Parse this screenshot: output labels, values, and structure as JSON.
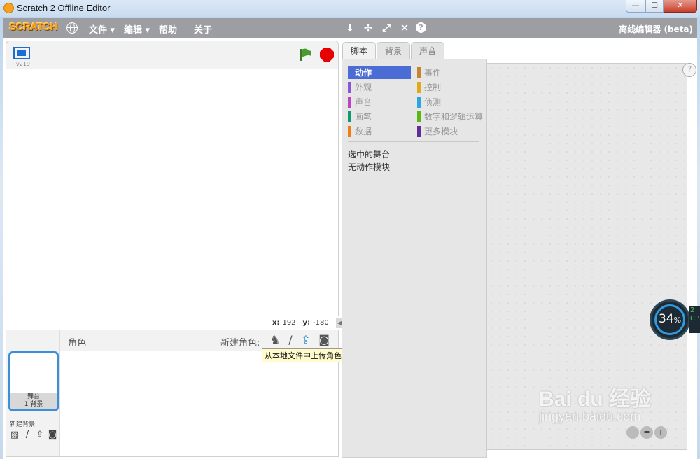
{
  "window": {
    "title": "Scratch 2 Offline Editor",
    "min": "—",
    "max": "☐",
    "close": "✕"
  },
  "menubar": {
    "logo": "SCRATCH",
    "file": "文件 ▾",
    "edit": "编辑 ▾",
    "help": "帮助",
    "about": "关于",
    "right_label": "离线编辑器 (beta)"
  },
  "stage": {
    "version": "v219",
    "x_label": "x:",
    "x_value": "192",
    "y_label": "y:",
    "y_value": "-180"
  },
  "tabs": [
    "脚本",
    "背景",
    "声音"
  ],
  "palette": {
    "categories_left": [
      {
        "label": "动作",
        "color": "#4a6cd4",
        "active": true
      },
      {
        "label": "外观",
        "color": "#8a55d7"
      },
      {
        "label": "声音",
        "color": "#bb42c3"
      },
      {
        "label": "画笔",
        "color": "#0e9a6c"
      },
      {
        "label": "数据",
        "color": "#ee7d16"
      }
    ],
    "categories_right": [
      {
        "label": "事件",
        "color": "#c88330"
      },
      {
        "label": "控制",
        "color": "#e1a91a"
      },
      {
        "label": "侦测",
        "color": "#2ca5e2"
      },
      {
        "label": "数字和逻辑运算",
        "color": "#5cb712"
      },
      {
        "label": "更多模块",
        "color": "#632d99"
      }
    ],
    "note_line1": "选中的舞台",
    "note_line2": "无动作模块"
  },
  "sprites": {
    "header": "角色",
    "new_sprite": "新建角色:",
    "stage_name": "舞台",
    "stage_backdrops": "1 背景",
    "new_backdrop": "新建背景",
    "tooltip": "从本地文件中上传角色"
  },
  "cpu": {
    "value": "34",
    "unit": "%"
  },
  "watermark": {
    "brand": "Bai du 经验",
    "url": "jingyan.baidu.com"
  }
}
